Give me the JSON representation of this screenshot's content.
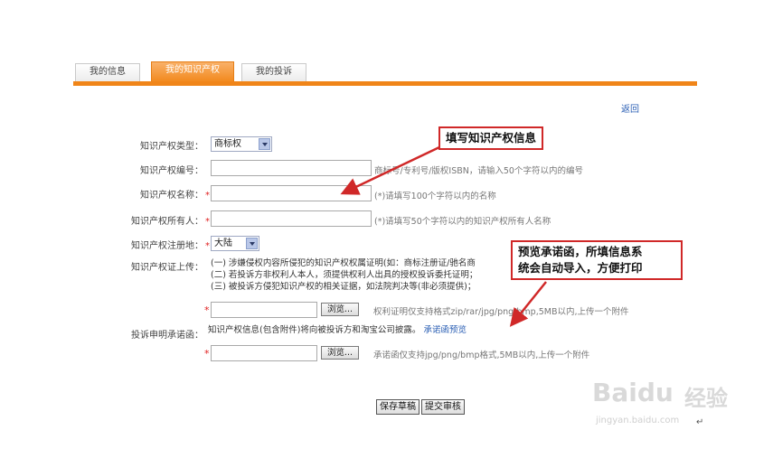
{
  "tabs": [
    {
      "label": "我的信息",
      "active": false
    },
    {
      "label": "我的知识产权",
      "active": true
    },
    {
      "label": "我的投诉",
      "active": false
    }
  ],
  "back_link": "返回",
  "form": {
    "ip_type": {
      "label": "知识产权类型：",
      "value": "商标权"
    },
    "ip_number": {
      "label": "知识产权编号：",
      "hint": "商标号/专利号/版权ISBN，请输入50个字符以内的编号"
    },
    "ip_name": {
      "label": "知识产权名称：",
      "required": "*",
      "hint": "(*)请填写100个字符以内的名称"
    },
    "ip_owner": {
      "label": "知识产权所有人：",
      "required": "*",
      "hint": "(*)请填写50个字符以内的知识产权所有人名称"
    },
    "ip_region": {
      "label": "知识产权注册地：",
      "required": "*",
      "value": "大陆"
    },
    "ip_cert": {
      "label": "知识产权证上传：",
      "notes": [
        "(一) 涉嫌侵权内容所侵犯的知识产权权属证明(如：商标注册证/驰名商",
        "(二) 若投诉方非权利人本人，须提供权利人出具的授权投诉委托证明；",
        "(三) 被投诉方侵犯知识产权的相关证据，如法院判决等(非必须提供)；"
      ],
      "required": "*",
      "browse_label": "浏览...",
      "hint": "权利证明仅支持格式zip/rar/jpg/png/bmp,5MB以内,上传一个附件"
    },
    "commitment": {
      "label": "投诉申明承诺函：",
      "text": "知识产权信息(包含附件)将向被投诉方和淘宝公司披露。",
      "link": "承诺函预览",
      "required": "*",
      "browse_label": "浏览...",
      "hint": "承诺函仅支持jpg/png/bmp格式,5MB以内,上传一个附件"
    }
  },
  "callouts": {
    "fill_info": "填写知识产权信息",
    "preview": [
      "预览承诺函，所填信息系",
      "统会自动导入，方便打印"
    ]
  },
  "buttons": {
    "save_draft": "保存草稿",
    "submit": "提交审核"
  },
  "watermark": {
    "brand": "Bai",
    "brand2": "du",
    "cn": "经验",
    "url": "jingyan.baidu.com"
  },
  "return_mark": "↵",
  "colors": {
    "accent": "#f08519",
    "callout_border": "#d02828",
    "link": "#2b5fb4"
  }
}
